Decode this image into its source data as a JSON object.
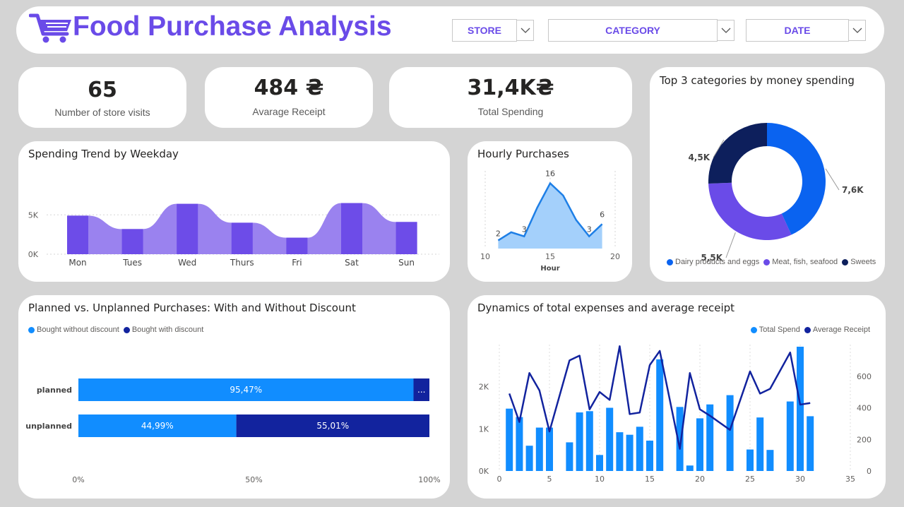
{
  "header": {
    "title": "Food Purchase Analysis",
    "filters": {
      "store": "STORE",
      "category": "CATEGORY",
      "date": "DATE"
    }
  },
  "kpis": {
    "visits": {
      "value": "65",
      "label": "Number of store visits"
    },
    "avg_receipt": {
      "value": "484 ₴",
      "label": "Avarage Receipt"
    },
    "total_spending": {
      "value": "31,4K₴",
      "label": "Total Spending"
    }
  },
  "colors": {
    "accent": "#6a4be8",
    "weekday_bar": "#6d4ce8",
    "weekday_area": "#9a82ef",
    "hourly_line": "#1e7fe6",
    "hourly_fill": "#a4d0fb",
    "donut": [
      "#0a63f0",
      "#6a4be8",
      "#0d1f5c"
    ],
    "without_discount": "#118dff",
    "with_discount": "#12239e",
    "total_spend": "#118dff",
    "avg_receipt_line": "#12239e"
  },
  "chart_data": [
    {
      "type": "area",
      "title": "Spending Trend by Weekday",
      "categories": [
        "Mon",
        "Tues",
        "Wed",
        "Thurs",
        "Fri",
        "Sat",
        "Sun"
      ],
      "values": [
        4900,
        3200,
        6400,
        4000,
        2100,
        6500,
        4100
      ],
      "yticks": [
        "0K",
        "5K"
      ],
      "ylim": [
        0,
        7000
      ]
    },
    {
      "type": "area",
      "title": "Hourly Purchases",
      "xlabel": "Hour",
      "x": [
        11,
        12,
        13,
        14,
        15,
        16,
        17,
        18,
        19
      ],
      "values": [
        2,
        4,
        3,
        10,
        16,
        13,
        7,
        3,
        6
      ],
      "data_labels": {
        "11": "2",
        "13": "3",
        "15": "16",
        "18": "3",
        "19": "6"
      },
      "xticks": [
        "10",
        "15",
        "20"
      ],
      "xlim": [
        10,
        20
      ],
      "ylim": [
        0,
        18
      ]
    },
    {
      "type": "pie",
      "title": "Top 3 categories by money spending",
      "categories": [
        "Dairy products and eggs",
        "Meat, fish, seafood",
        "Sweets"
      ],
      "values": [
        7600,
        5500,
        4500
      ],
      "labels": [
        "7,6K",
        "5,5K",
        "4,5K"
      ],
      "legend": "bottom"
    },
    {
      "type": "bar",
      "title": "Planned vs. Unplanned Purchases: With and Without Discount",
      "categories": [
        "planned",
        "unplanned"
      ],
      "series": [
        {
          "name": "Bought without discount",
          "values": [
            95.47,
            44.99
          ],
          "labels": [
            "95,47%",
            "44,99%"
          ]
        },
        {
          "name": "Bought with discount",
          "values": [
            4.53,
            55.01
          ],
          "labels": [
            "...",
            "55,01%"
          ]
        }
      ],
      "xticks": [
        "0%",
        "50%",
        "100%"
      ],
      "legend": "top-left"
    },
    {
      "type": "bar",
      "title": "Dynamics of total expenses and average receipt",
      "x": [
        1,
        2,
        3,
        4,
        5,
        7,
        8,
        9,
        10,
        11,
        12,
        13,
        14,
        15,
        16,
        18,
        19,
        20,
        21,
        23,
        25,
        26,
        27,
        29,
        30,
        31
      ],
      "series": [
        {
          "name": "Total Spend",
          "values": [
            1480,
            1280,
            600,
            1030,
            1030,
            680,
            1390,
            1420,
            380,
            1500,
            920,
            860,
            1050,
            720,
            2650,
            1520,
            130,
            1250,
            1580,
            1800,
            510,
            1270,
            500,
            1650,
            2950,
            1300
          ]
        },
        {
          "name": "Average Receipt",
          "values": [
            490,
            310,
            620,
            510,
            250,
            700,
            730,
            390,
            500,
            450,
            790,
            360,
            370,
            670,
            760,
            140,
            620,
            390,
            350,
            260,
            630,
            490,
            520,
            750,
            420,
            430
          ]
        }
      ],
      "xticks": [
        "0",
        "5",
        "10",
        "15",
        "20",
        "25",
        "30",
        "35"
      ],
      "yticks_left": [
        "0K",
        "1K",
        "2K"
      ],
      "yticks_right": [
        "0",
        "200",
        "400",
        "600"
      ],
      "xlim": [
        0,
        35
      ],
      "ylim_left": [
        0,
        3000
      ],
      "ylim_right": [
        0,
        800
      ],
      "legend": "top-right"
    }
  ]
}
